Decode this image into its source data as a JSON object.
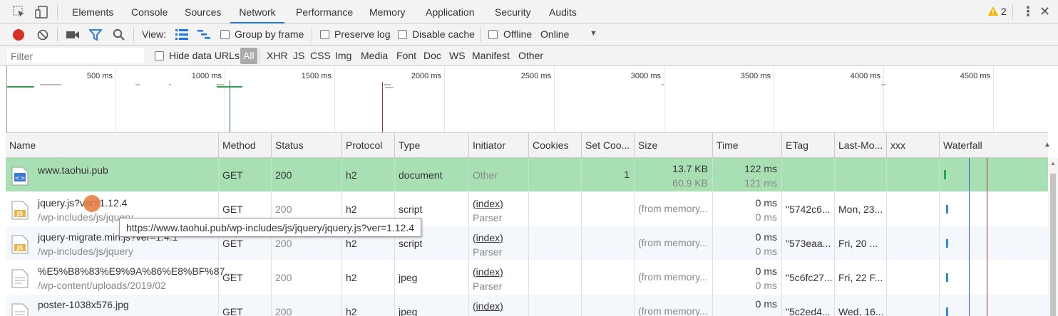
{
  "tabs": {
    "elements": "Elements",
    "console": "Console",
    "sources": "Sources",
    "network": "Network",
    "performance": "Performance",
    "memory": "Memory",
    "application": "Application",
    "security": "Security",
    "audits": "Audits"
  },
  "warnings_count": "2",
  "toolbar": {
    "view_label": "View:",
    "group_by_frame": "Group by frame",
    "preserve_log": "Preserve log",
    "disable_cache": "Disable cache",
    "offline": "Offline",
    "throttle": "Online"
  },
  "filter": {
    "placeholder": "Filter",
    "hide_data_urls": "Hide data URLs",
    "types": [
      "All",
      "XHR",
      "JS",
      "CSS",
      "Img",
      "Media",
      "Font",
      "Doc",
      "WS",
      "Manifest",
      "Other"
    ]
  },
  "overview_ticks": [
    "500 ms",
    "1000 ms",
    "1500 ms",
    "2000 ms",
    "2500 ms",
    "3000 ms",
    "3500 ms",
    "4000 ms",
    "4500 ms"
  ],
  "columns": [
    "Name",
    "Method",
    "Status",
    "Protocol",
    "Type",
    "Initiator",
    "Cookies",
    "Set Coo...",
    "Size",
    "Time",
    "ETag",
    "Last-Mo...",
    "xxx",
    "Waterfall"
  ],
  "rows": [
    {
      "name": "www.taohui.pub",
      "path": "",
      "method": "GET",
      "status": "200",
      "protocol": "h2",
      "type": "document",
      "initiator": "Other",
      "initiator_sub": "",
      "cookies": "",
      "set_cookies": "1",
      "size": "13.7 KB",
      "size_sub": "60.9 KB",
      "time": "122 ms",
      "time_sub": "121 ms",
      "etag": "",
      "last_modified": "",
      "xxx": ""
    },
    {
      "name": "jquery.js?ver=1.12.4",
      "path": "/wp-includes/js/jquery",
      "method": "GET",
      "status": "200",
      "protocol": "h2",
      "type": "script",
      "initiator": "(index)",
      "initiator_sub": "Parser",
      "cookies": "",
      "set_cookies": "",
      "size": "(from memory...",
      "size_sub": "",
      "time": "0 ms",
      "time_sub": "0 ms",
      "etag": "\"5742c6...",
      "last_modified": "Mon, 23...",
      "xxx": ""
    },
    {
      "name": "jquery-migrate.min.js?ver=1.4.1",
      "path": "/wp-includes/js/jquery",
      "method": "GET",
      "status": "200",
      "protocol": "h2",
      "type": "script",
      "initiator": "(index)",
      "initiator_sub": "Parser",
      "cookies": "",
      "set_cookies": "",
      "size": "(from memory...",
      "size_sub": "",
      "time": "0 ms",
      "time_sub": "0 ms",
      "etag": "\"573eaa...",
      "last_modified": "Fri, 20 ...",
      "xxx": ""
    },
    {
      "name": "%E5%B8%83%E9%9A%86%E8%BF%87...",
      "path": "/wp-content/uploads/2019/02",
      "method": "GET",
      "status": "200",
      "protocol": "h2",
      "type": "jpeg",
      "initiator": "(index)",
      "initiator_sub": "Parser",
      "cookies": "",
      "set_cookies": "",
      "size": "(from memory...",
      "size_sub": "",
      "time": "0 ms",
      "time_sub": "0 ms",
      "etag": "\"5c6fc27...",
      "last_modified": "Fri, 22 F...",
      "xxx": ""
    },
    {
      "name": "poster-1038x576.jpg",
      "path": "",
      "method": "GET",
      "status": "200",
      "protocol": "h2",
      "type": "jpeg",
      "initiator": "(index)",
      "initiator_sub": "",
      "cookies": "",
      "set_cookies": "",
      "size": "(from memory...",
      "size_sub": "",
      "time": "0 ms",
      "time_sub": "",
      "etag": "\"5c2ed4...",
      "last_modified": "Wed, 16...",
      "xxx": ""
    }
  ],
  "tooltip": "https://www.taohui.pub/wp-includes/js/jquery/jquery.js?ver=1.12.4",
  "colors": {
    "selected_row": "#a8e0b4",
    "accent": "#1a73e8",
    "record": "#d93025"
  }
}
